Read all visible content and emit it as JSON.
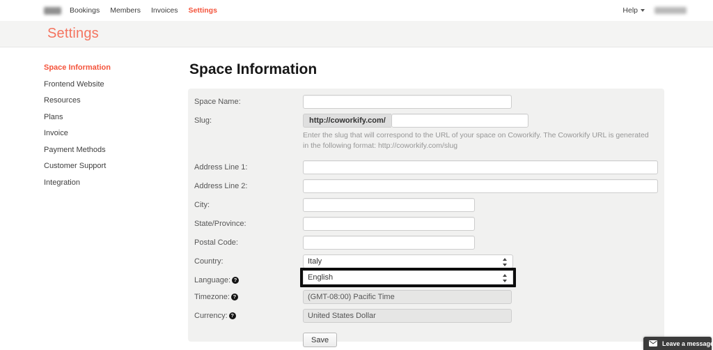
{
  "navbar": {
    "links": [
      {
        "label": "Bookings",
        "active": false
      },
      {
        "label": "Members",
        "active": false
      },
      {
        "label": "Invoices",
        "active": false
      },
      {
        "label": "Settings",
        "active": true
      }
    ],
    "help_label": "Help"
  },
  "page_header": {
    "title": "Settings"
  },
  "sidebar": {
    "items": [
      {
        "label": "Space Information",
        "active": true
      },
      {
        "label": "Frontend Website",
        "active": false
      },
      {
        "label": "Resources",
        "active": false
      },
      {
        "label": "Plans",
        "active": false
      },
      {
        "label": "Invoice",
        "active": false
      },
      {
        "label": "Payment Methods",
        "active": false
      },
      {
        "label": "Customer Support",
        "active": false
      },
      {
        "label": "Integration",
        "active": false
      }
    ]
  },
  "main": {
    "heading": "Space Information",
    "form": {
      "space_name": {
        "label": "Space Name:",
        "value": ""
      },
      "slug": {
        "label": "Slug:",
        "addon": "http://coworkify.com/",
        "value": "",
        "help": "Enter the slug that will correspond to the URL of your space on Coworkify. The Coworkify URL is generated in the following format: http://coworkify.com/slug"
      },
      "address1": {
        "label": "Address Line 1:",
        "value": ""
      },
      "address2": {
        "label": "Address Line 2:",
        "value": ""
      },
      "city": {
        "label": "City:",
        "value": ""
      },
      "state": {
        "label": "State/Province:",
        "value": ""
      },
      "postal": {
        "label": "Postal Code:",
        "value": ""
      },
      "country": {
        "label": "Country:",
        "value": "Italy"
      },
      "language": {
        "label": "Language:",
        "value": "English",
        "highlighted": true
      },
      "timezone": {
        "label": "Timezone:",
        "value": "(GMT-08:00) Pacific Time",
        "readonly": true
      },
      "currency": {
        "label": "Currency:",
        "value": "United States Dollar",
        "readonly": true
      },
      "save_label": "Save"
    }
  },
  "chat_widget": {
    "label": "Leave a message"
  },
  "icons": {
    "help_glyph": "?"
  },
  "colors": {
    "accent": "#f4543c",
    "title": "#f4745f",
    "panel_bg": "#f1f1f0",
    "header_band_bg": "#f4f4f3",
    "widget_bg": "#3b3b3b",
    "addon_bg": "#dfdfdf",
    "readonly_bg": "#e6e6e5",
    "highlight_border": "#0d0d0d"
  }
}
